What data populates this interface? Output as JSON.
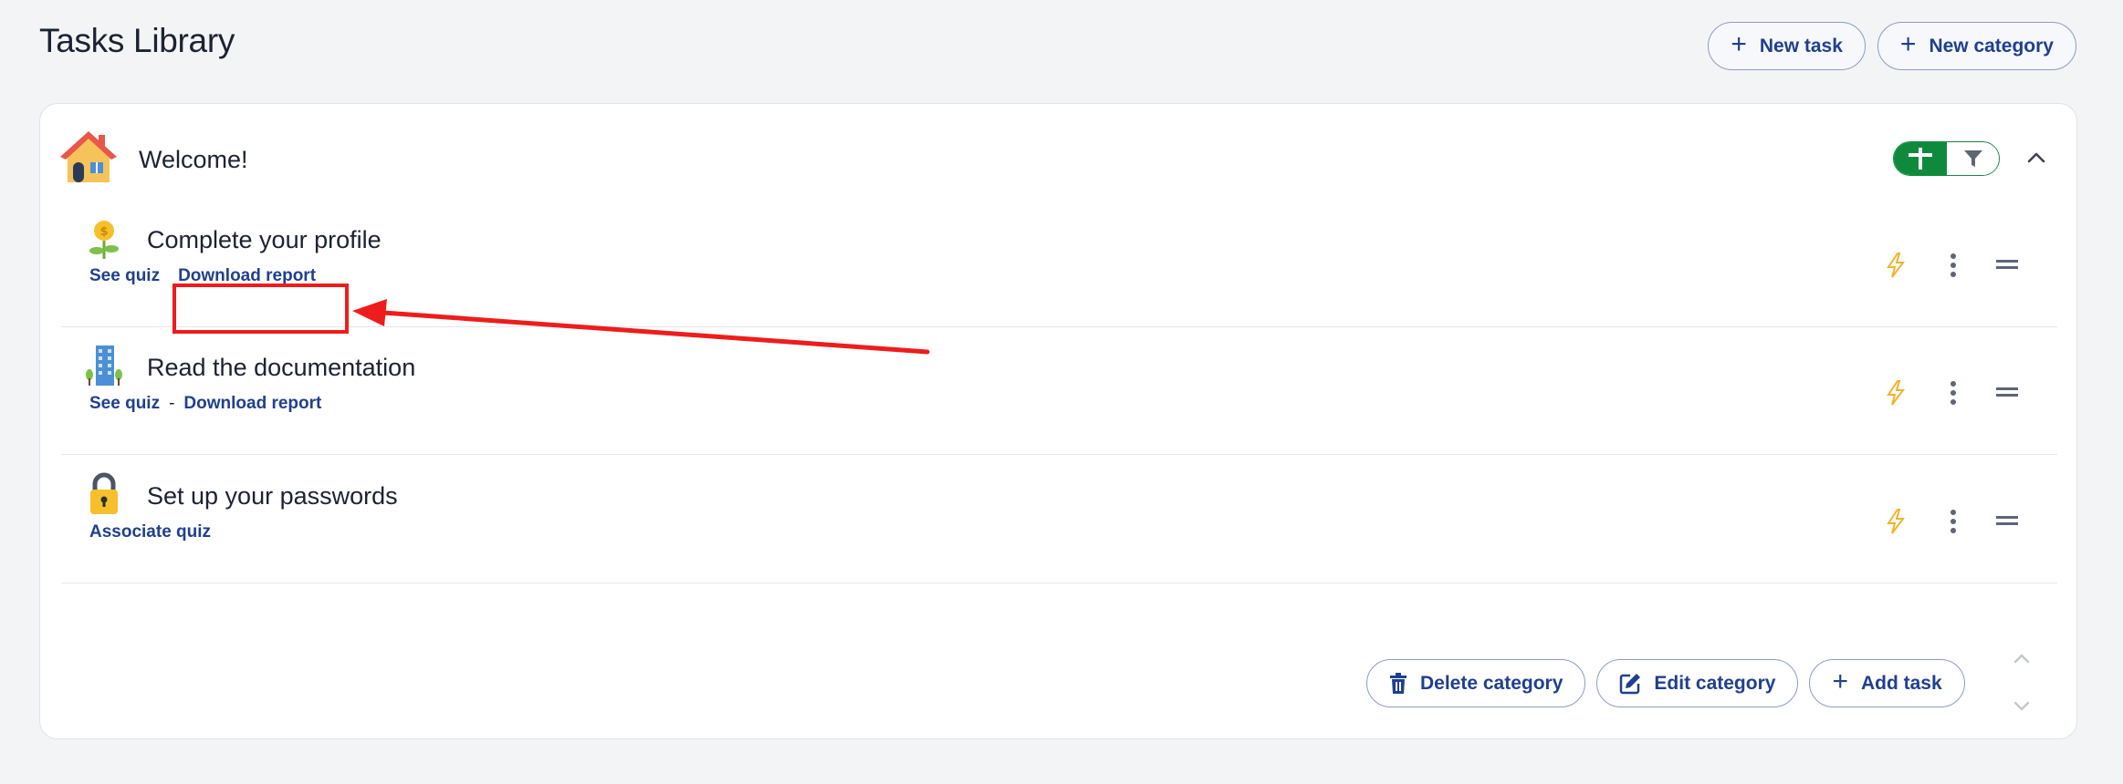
{
  "header": {
    "title": "Tasks Library",
    "new_task_label": "New task",
    "new_category_label": "New category"
  },
  "category": {
    "title": "Welcome!",
    "icon": "house-emoji"
  },
  "tasks": [
    {
      "title": "Complete your profile",
      "icon": "coin-plant-emoji",
      "links": [
        "See quiz",
        "Download report"
      ],
      "separator": ""
    },
    {
      "title": "Read the documentation",
      "icon": "office-building-emoji",
      "links": [
        "See quiz",
        "Download report"
      ],
      "separator": "-"
    },
    {
      "title": "Set up your passwords",
      "icon": "lock-emoji",
      "links": [
        "Associate quiz"
      ],
      "separator": ""
    }
  ],
  "footer": {
    "delete_label": "Delete category",
    "edit_label": "Edit category",
    "add_label": "Add task"
  },
  "colors": {
    "accent_blue": "#1f3f8f",
    "toggle_green": "#0f8a3c",
    "bolt_yellow": "#f0b429",
    "annotation_red": "#ee1c1c"
  }
}
